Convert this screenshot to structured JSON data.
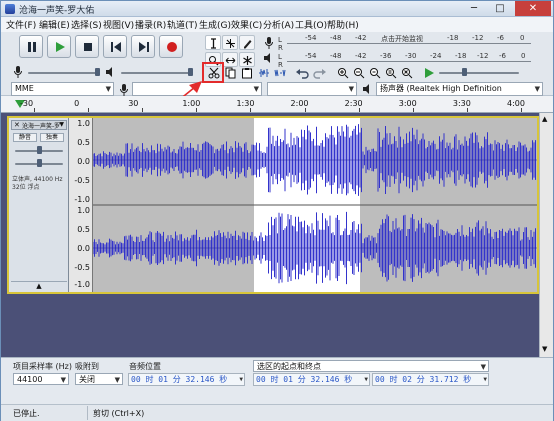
{
  "window": {
    "title": "沧海一声笑-罗大佑",
    "minimize": "─",
    "maximize": "□",
    "close": "✕"
  },
  "menu": [
    "文件(F)",
    "编辑(E)",
    "选择(S)",
    "视图(V)",
    "播录(R)",
    "轨道(T)",
    "生成(G)",
    "效果(C)",
    "分析(A)",
    "工具(O)",
    "帮助(H)"
  ],
  "toolbar": {
    "transport": [
      {
        "name": "pause-button",
        "icon": "pause-icon"
      },
      {
        "name": "play-button",
        "icon": "play-icon"
      },
      {
        "name": "stop-button",
        "icon": "stop-icon"
      },
      {
        "name": "skip-start-button",
        "icon": "skip-start-icon"
      },
      {
        "name": "skip-end-button",
        "icon": "skip-end-icon"
      },
      {
        "name": "record-button",
        "icon": "record-icon"
      }
    ],
    "meter_ticks_top": [
      "-54",
      "-48",
      "-42",
      "点击开始监视",
      "-18",
      "-12",
      "-6",
      "0"
    ],
    "meter_ticks_bottom": [
      "-54",
      "-48",
      "-42",
      "-36",
      "-30",
      "-24",
      "-18",
      "-12",
      "-6",
      "0"
    ],
    "meter_L": "L",
    "meter_R": "R",
    "host": "MME",
    "output_device": "扬声器 (Realtek High Definition",
    "accent_color": "#2a55b0",
    "record_color": "#d11f1f",
    "play_color": "#2f9e3b"
  },
  "ruler": {
    "labels": [
      "-30",
      "0",
      "30",
      "1:00",
      "1:30",
      "2:00",
      "2:30",
      "3:00",
      "3:30",
      "4:00"
    ],
    "range_seconds": [
      -30,
      240
    ],
    "selection_seconds": [
      92,
      151
    ]
  },
  "track": {
    "name": "沧海一声笑-罗",
    "mute": "静音",
    "solo": "独奏",
    "info_line1": "立体声, 44100 Hz",
    "info_line2": "32位 浮点",
    "scale_top": [
      "1.0",
      "0.5",
      "0.0",
      "-0.5",
      "-1.0"
    ],
    "scale_bottom": [
      "1.0",
      "0.5",
      "0.0",
      "-0.5",
      "-1.0"
    ],
    "wave_color": "#3333cc",
    "selection_color": "#ffffff",
    "track_bg": "#bdbdbd"
  },
  "bottom": {
    "rate_label": "项目采样率 (Hz)",
    "rate_value": "44100",
    "snap_label": "吸附到",
    "snap_value": "关闭",
    "position_label": "音频位置",
    "position_value": "00 时 01 分 32.146 秒",
    "selection_mode": "选区的起点和终点",
    "start_value": "00 时 01 分 32.146 秒",
    "end_value": "00 时 02 分 31.712 秒"
  },
  "status": {
    "left": "已停止.",
    "right": "剪切 (Ctrl+X)"
  }
}
